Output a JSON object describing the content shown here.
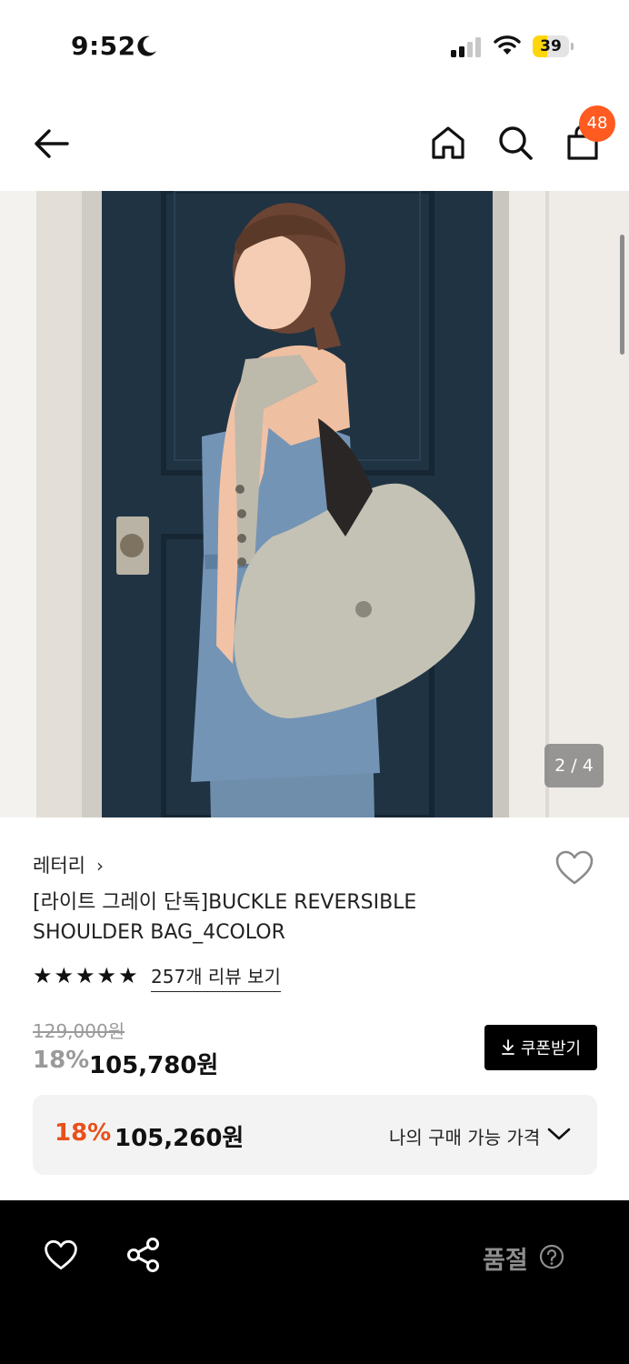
{
  "status_bar": {
    "time": "9:52",
    "battery_level": "39",
    "battery_fraction": 0.39,
    "icons": [
      "moon-icon",
      "signal-icon",
      "wifi-icon",
      "battery-icon"
    ],
    "battery_color": "#ffd60a"
  },
  "nav": {
    "icons": [
      "back-arrow-icon",
      "home-icon",
      "search-icon",
      "shopping-bag-icon"
    ],
    "cart_count": "48",
    "badge_color": "#ff5a1f"
  },
  "hero": {
    "page_indicator": "2 / 4"
  },
  "product": {
    "brand": "레터리",
    "brand_chevron": "›",
    "title": "[라이트 그레이 단독]BUCKLE REVERSIBLE SHOULDER BAG_4COLOR",
    "rating_stars": 5,
    "reviews_link": "257개 리뷰 보기",
    "original_price": "129,000원",
    "discount_rate": "18%",
    "sale_price": "105,780원",
    "coupon_button": "쿠폰받기"
  },
  "my_price": {
    "discount_rate": "18%",
    "price": "105,260원",
    "label": "나의 구매 가능 가격",
    "accent_color": "#e8501a"
  },
  "bottom_bar": {
    "status": "품절",
    "icons": [
      "heart-icon",
      "share-icon",
      "help-icon"
    ]
  }
}
